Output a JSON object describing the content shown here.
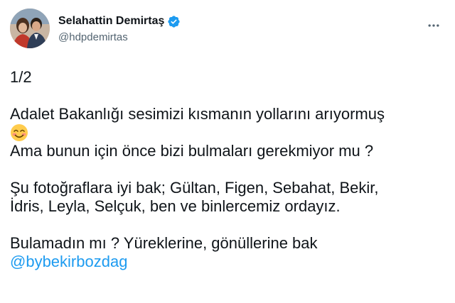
{
  "author": {
    "display_name": "Selahattin Demirtaş",
    "handle": "@hdpdemirtas",
    "verified": true,
    "verified_color": "#1d9bf0"
  },
  "menu": {
    "icon": "more-horizontal-icon"
  },
  "tweet": {
    "thread_marker": "1/2",
    "line1": "Adalet Bakanlığı sesimizi kısmanın yollarını arıyormuş",
    "emoji": "smiling-face-icon",
    "line2": "Ama bunun için önce bizi bulmaları gerekmiyor mu ?",
    "line3": "Şu fotoğraflara iyi bak; Gültan, Figen, Sebahat, Bekir,",
    "line4": "İdris, Leyla, Selçuk, ben ve binlercemiz ordayız.",
    "line5": "Bulamadın mı ? Yüreklerine, gönüllerine bak",
    "mention": "@bybekirbozdag",
    "mention_color": "#1d9bf0"
  }
}
